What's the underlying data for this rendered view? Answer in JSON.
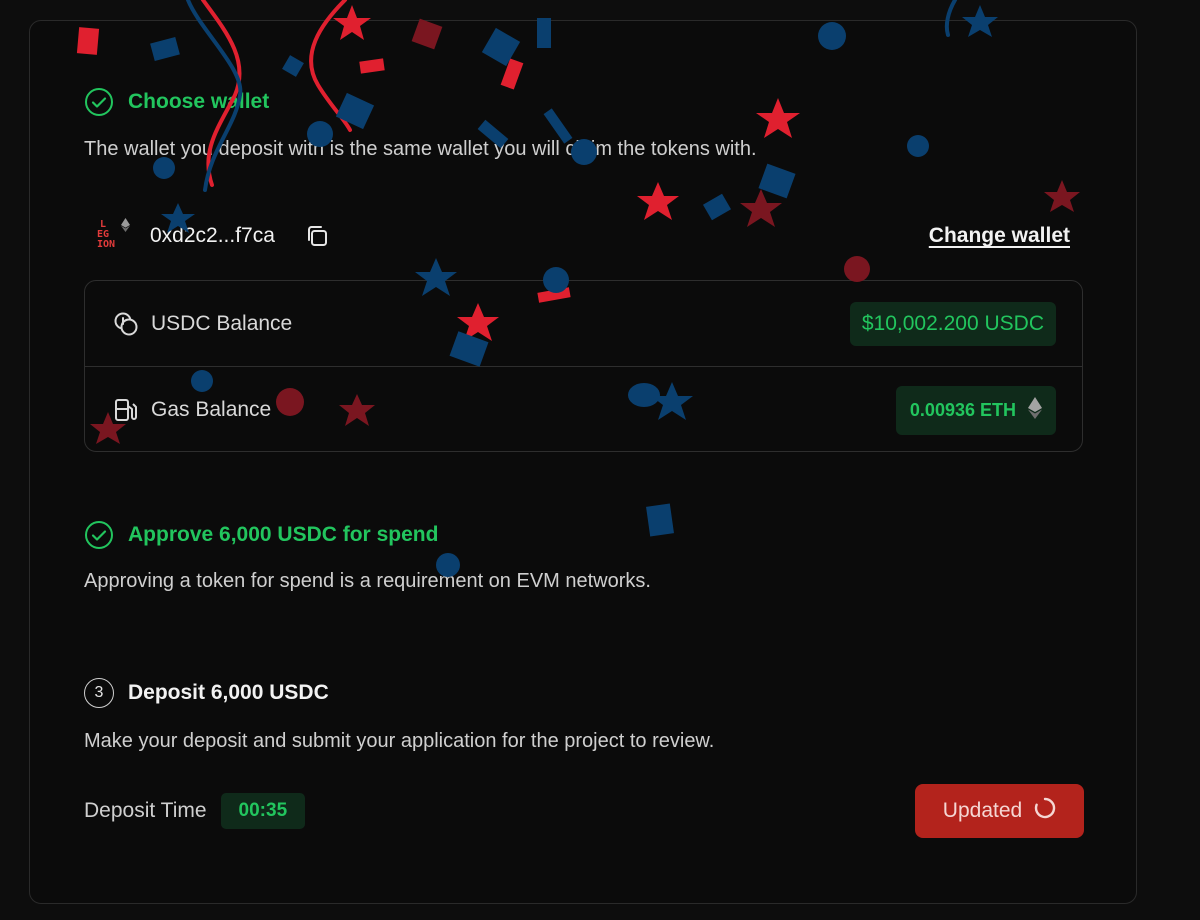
{
  "steps": [
    {
      "status": "done",
      "title": "Choose wallet",
      "description": "The wallet you deposit with is the same wallet you will claim the tokens with."
    },
    {
      "status": "done",
      "title": "Approve 6,000 USDC for spend",
      "description": "Approving a token for spend is a requirement on EVM networks."
    },
    {
      "status": "pending",
      "number": "3",
      "title": "Deposit 6,000 USDC",
      "description": "Make your deposit and submit your application for the project to review."
    }
  ],
  "wallet": {
    "logo_lines": [
      "L",
      "EG",
      "ION"
    ],
    "address": "0xd2c2...f7ca",
    "change_label": "Change wallet"
  },
  "balances": {
    "usdc": {
      "label": "USDC Balance",
      "value": "$10,002.200 USDC"
    },
    "gas": {
      "label": "Gas Balance",
      "value": "0.00936 ETH"
    }
  },
  "deposit": {
    "time_label": "Deposit Time",
    "timer": "00:35",
    "button_label": "Updated"
  },
  "icons": {
    "check": "check-circle-icon",
    "copy": "copy-icon",
    "coins": "coins-icon",
    "fuel": "fuel-pump-icon",
    "eth": "ethereum-icon",
    "spinner": "spinner-icon"
  },
  "colors": {
    "success": "#22c55e",
    "success_bg": "#0f2a1a",
    "danger": "#b3231c",
    "confetti_red": "#e0202f",
    "confetti_blue": "#0a3f6e"
  }
}
